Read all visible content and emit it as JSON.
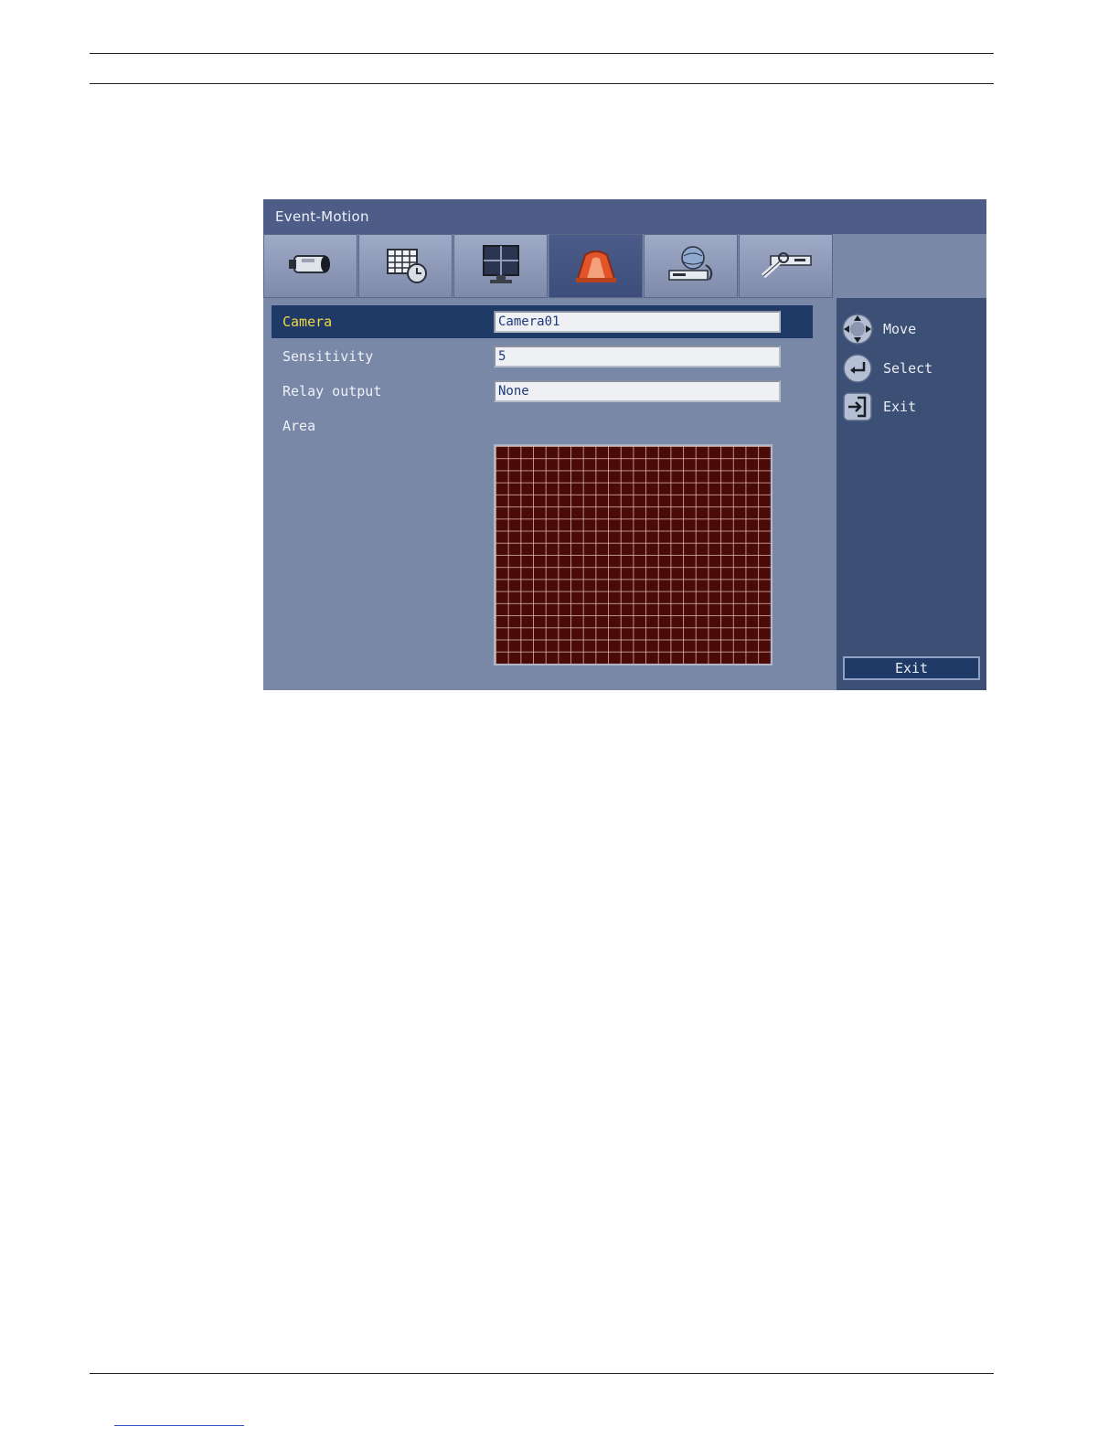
{
  "window": {
    "title": "Event-Motion"
  },
  "tabs": [
    {
      "icon": "camera-icon"
    },
    {
      "icon": "schedule-icon"
    },
    {
      "icon": "monitor-icon"
    },
    {
      "icon": "alarm-icon",
      "active": true
    },
    {
      "icon": "network-icon"
    },
    {
      "icon": "system-tools-icon"
    }
  ],
  "form": {
    "camera": {
      "label": "Camera",
      "value": "Camera01"
    },
    "sensitivity": {
      "label": "Sensitivity",
      "value": "5"
    },
    "relay_output": {
      "label": "Relay output",
      "value": "None"
    },
    "area": {
      "label": "Area"
    }
  },
  "motion_grid": {
    "columns": 22,
    "rows": 18
  },
  "hints": {
    "move": "Move",
    "select": "Select",
    "exit": "Exit"
  },
  "buttons": {
    "exit": "Exit"
  },
  "colors": {
    "title_bar": "#4d5d88",
    "panel": "#7a88a8",
    "sidebar": "#3c4f74",
    "selected_row": "#1f3a66",
    "selected_label": "#f2d64a",
    "grid_cell": "#4a0a08"
  }
}
